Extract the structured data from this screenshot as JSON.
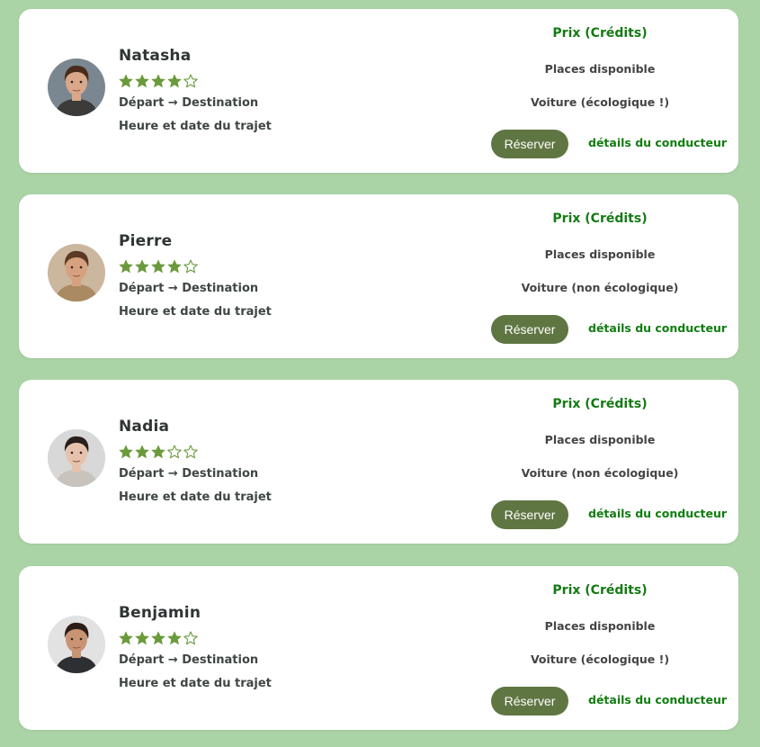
{
  "colors": {
    "page_background": "#abd4a6",
    "card_background": "#ffffff",
    "accent_green": "#157a14",
    "button_olive": "#5f7642",
    "star_green": "#6a9a3c"
  },
  "icons": {
    "star_filled": "star-filled-icon",
    "star_empty": "star-outline-icon"
  },
  "rides": [
    {
      "driver_name": "Natasha",
      "rating": 4,
      "rating_max": 5,
      "route": "Départ → Destination",
      "datetime": "Heure et date du trajet",
      "price": "Prix (Crédits)",
      "seats": "Places disponible",
      "vehicle": "Voiture (écologique !)",
      "book_label": "Réserver",
      "details_label": "détails du conducteur",
      "avatar": {
        "hair": "#4a2c1c",
        "skin": "#d9a78a",
        "bg": "#7b8790",
        "shirt": "#3d3a3a"
      }
    },
    {
      "driver_name": "Pierre",
      "rating": 4,
      "rating_max": 5,
      "route": "Départ → Destination",
      "datetime": "Heure et date du trajet",
      "price": "Prix (Crédits)",
      "seats": "Places disponible",
      "vehicle": "Voiture (non écologique)",
      "book_label": "Réserver",
      "details_label": "détails du conducteur",
      "avatar": {
        "hair": "#5a3a24",
        "skin": "#d7a17f",
        "bg": "#cbb69e",
        "shirt": "#a98a62"
      }
    },
    {
      "driver_name": "Nadia",
      "rating": 3,
      "rating_max": 5,
      "route": "Départ → Destination",
      "datetime": "Heure et date du trajet",
      "price": "Prix (Crédits)",
      "seats": "Places disponible",
      "vehicle": "Voiture (non écologique)",
      "book_label": "Réserver",
      "details_label": "détails du conducteur",
      "avatar": {
        "hair": "#2a1f1b",
        "skin": "#e6c2ad",
        "bg": "#d8d8d8",
        "shirt": "#c9c3bd"
      }
    },
    {
      "driver_name": "Benjamin",
      "rating": 4,
      "rating_max": 5,
      "route": "Départ → Destination",
      "datetime": "Heure et date du trajet",
      "price": "Prix (Crédits)",
      "seats": "Places disponible",
      "vehicle": "Voiture (écologique !)",
      "book_label": "Réserver",
      "details_label": "détails du conducteur",
      "avatar": {
        "hair": "#2b1d15",
        "skin": "#c99474",
        "bg": "#e2e2e2",
        "shirt": "#2e2f33"
      }
    }
  ]
}
